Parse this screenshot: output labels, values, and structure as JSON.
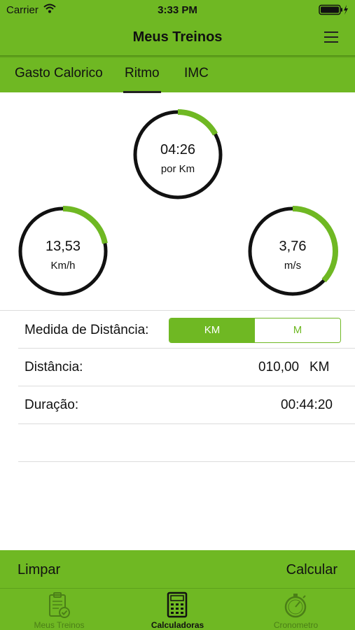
{
  "status_bar": {
    "carrier": "Carrier",
    "time": "3:33 PM"
  },
  "nav": {
    "title": "Meus Treinos"
  },
  "tabs": [
    {
      "label": "Gasto Calorico"
    },
    {
      "label": "Ritmo",
      "selected": true
    },
    {
      "label": "IMC"
    }
  ],
  "gauges": {
    "pace": {
      "value": "04:26",
      "unit": "por Km",
      "fill_fraction": 0.17
    },
    "speed_kmh": {
      "value": "13,53",
      "unit": "Km/h",
      "fill_fraction": 0.22
    },
    "speed_ms": {
      "value": "3,76",
      "unit": "m/s",
      "fill_fraction": 0.37
    }
  },
  "form": {
    "distance_unit_label": "Medida de Distância:",
    "unit_options": [
      "KM",
      "M"
    ],
    "unit_selected": "KM",
    "distance_label": "Distância:",
    "distance_value": "010,00",
    "distance_unit": "KM",
    "duration_label": "Duração:",
    "duration_value": "00:44:20"
  },
  "actions": {
    "clear": "Limpar",
    "calculate": "Calcular"
  },
  "tabbar": [
    {
      "label": "Meus Treinos",
      "icon": "clipboard-check-icon"
    },
    {
      "label": "Calculadoras",
      "icon": "calculator-icon",
      "selected": true
    },
    {
      "label": "Cronometro",
      "icon": "stopwatch-icon"
    }
  ],
  "colors": {
    "accent": "#6fb823",
    "ring": "#111111",
    "inactive_tab": "#4b7f17"
  }
}
